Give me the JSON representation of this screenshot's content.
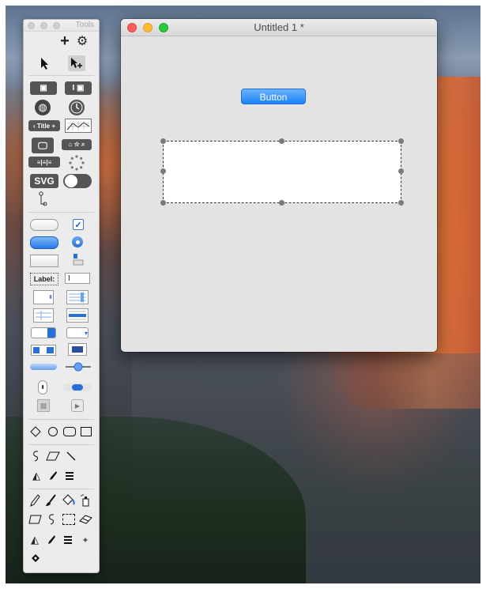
{
  "tools_window": {
    "title": "Tools",
    "icons": [
      "plus-icon",
      "gear-icon",
      "arrow-pointer-icon",
      "move-select-icon",
      "android-icon",
      "text-cursor-android-icon",
      "globe-icon",
      "clock-icon",
      "navbar-title-icon",
      "chart-grid-icon",
      "monitor-icon",
      "search-bar-icon",
      "segmented-control-icon",
      "spinner-icon",
      "svg-icon",
      "toggle-switch-icon",
      "tree-icon",
      "push-button-icon",
      "checkbox-icon",
      "blue-button-icon",
      "radio-button-icon",
      "square-button-icon",
      "disclosure-icon",
      "label-icon",
      "text-field-icon",
      "stepper-field-icon",
      "list-view-icon",
      "table-icon",
      "form-icon",
      "popup-button-icon",
      "pulldown-button-icon",
      "combo-box-icon",
      "color-well-icon",
      "progress-bar-icon",
      "slider-icon",
      "vertical-stepper-icon",
      "horizontal-scroller-icon",
      "image-well-icon",
      "play-button-icon",
      "diamond-shape-icon",
      "circle-shape-icon",
      "rounded-rect-shape-icon",
      "rectangle-shape-icon",
      "lasso-icon",
      "polygon-icon",
      "line-icon",
      "fill-icon",
      "pen-icon",
      "menu-lines-icon",
      "pencil-icon",
      "brush-icon",
      "paint-bucket-icon",
      "spray-icon",
      "freeform-icon",
      "lasso2-icon",
      "marquee-icon",
      "eraser-icon",
      "fill2-icon",
      "pen2-icon",
      "menu-lines2-icon",
      "sparkle-icon",
      "diamond-small-icon"
    ],
    "labels": {
      "svg": "SVG",
      "title": "Title",
      "label": "Label:"
    }
  },
  "document_window": {
    "title": "Untitled 1 *",
    "button_label": "Button"
  },
  "colors": {
    "accent": "#1a82fb",
    "close": "#fc5f57",
    "minimize": "#fdbc2f",
    "maximize": "#29c940"
  }
}
